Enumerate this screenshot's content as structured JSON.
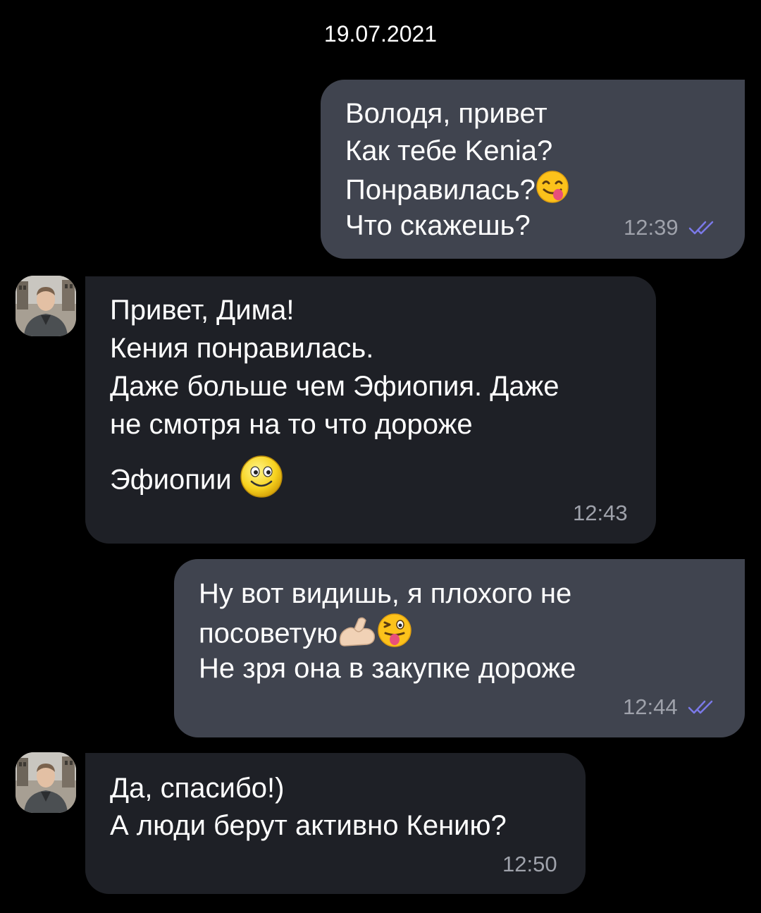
{
  "chat": {
    "date": "19.07.2021",
    "messages": [
      {
        "direction": "outgoing",
        "lines": [
          "Володя, привет",
          "Как тебе Kenia?",
          "Понравилась?",
          "Что скажешь?"
        ],
        "emojis": [
          "face-savoring-food-emoji"
        ],
        "time": "12:39",
        "status": "read"
      },
      {
        "direction": "incoming",
        "lines": [
          "Привет, Дима!",
          "Кения понравилась.",
          "Даже больше чем Эфиопия. Даже",
          "не смотря на то что дороже",
          "Эфиопии"
        ],
        "emojis": [
          "smiling-face-emoji"
        ],
        "time": "12:43"
      },
      {
        "direction": "outgoing",
        "lines": [
          "Ну вот видишь, я плохого не",
          "посоветую",
          "Не зря она в закупке дороже"
        ],
        "emojis": [
          "flexed-biceps-emoji",
          "winking-tongue-face-emoji"
        ],
        "time": "12:44",
        "status": "read"
      },
      {
        "direction": "incoming",
        "lines": [
          "Да, спасибо!)",
          "А люди берут активно Кению?"
        ],
        "time": "12:50"
      }
    ]
  },
  "colors": {
    "background": "#000000",
    "outgoing_bubble": "#40444f",
    "incoming_bubble": "#1e2026",
    "text": "#ffffff",
    "time_text": "#9fa2ab",
    "read_check": "#7b79e8"
  },
  "icons": {
    "read_status": "double-check-icon",
    "avatar": "contact-avatar"
  }
}
